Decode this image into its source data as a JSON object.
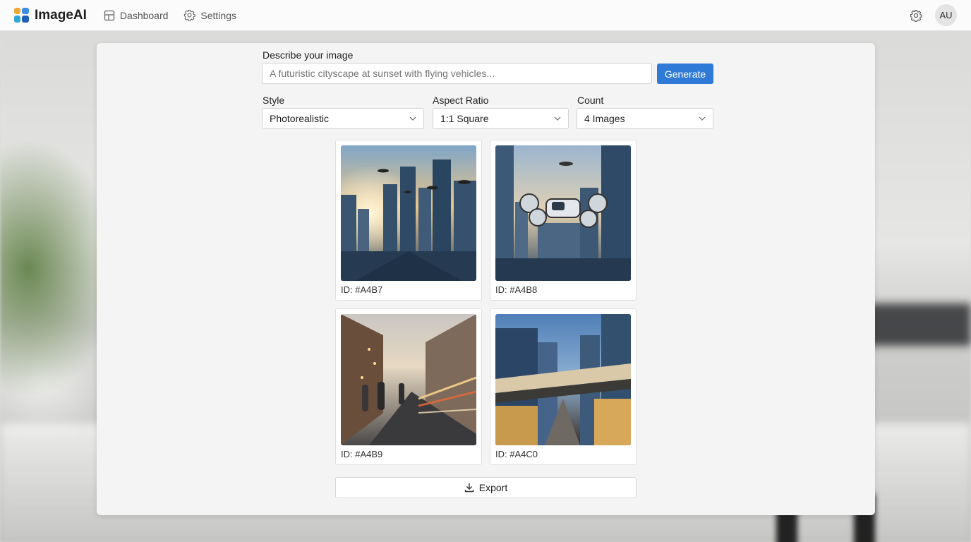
{
  "app": {
    "name": "ImageAI"
  },
  "nav": [
    {
      "label": "Dashboard",
      "icon": "dashboard-icon"
    },
    {
      "label": "Settings",
      "icon": "gear-icon"
    }
  ],
  "user": {
    "initials": "AU"
  },
  "prompt": {
    "label": "Describe your image",
    "placeholder": "A futuristic cityscape at sunset with flying vehicles...",
    "generate_label": "Generate"
  },
  "options": {
    "style": {
      "label": "Style",
      "value": "Photorealistic"
    },
    "aspect_ratio": {
      "label": "Aspect Ratio",
      "value": "1:1 Square"
    },
    "count": {
      "label": "Count",
      "value": "4 Images"
    }
  },
  "results": [
    {
      "id": "ID: #A4B7"
    },
    {
      "id": "ID: #A4B8"
    },
    {
      "id": "ID: #A4B9"
    },
    {
      "id": "ID: #A4C0"
    }
  ],
  "export_label": "Export",
  "colors": {
    "accent": "#2f7ad6"
  }
}
